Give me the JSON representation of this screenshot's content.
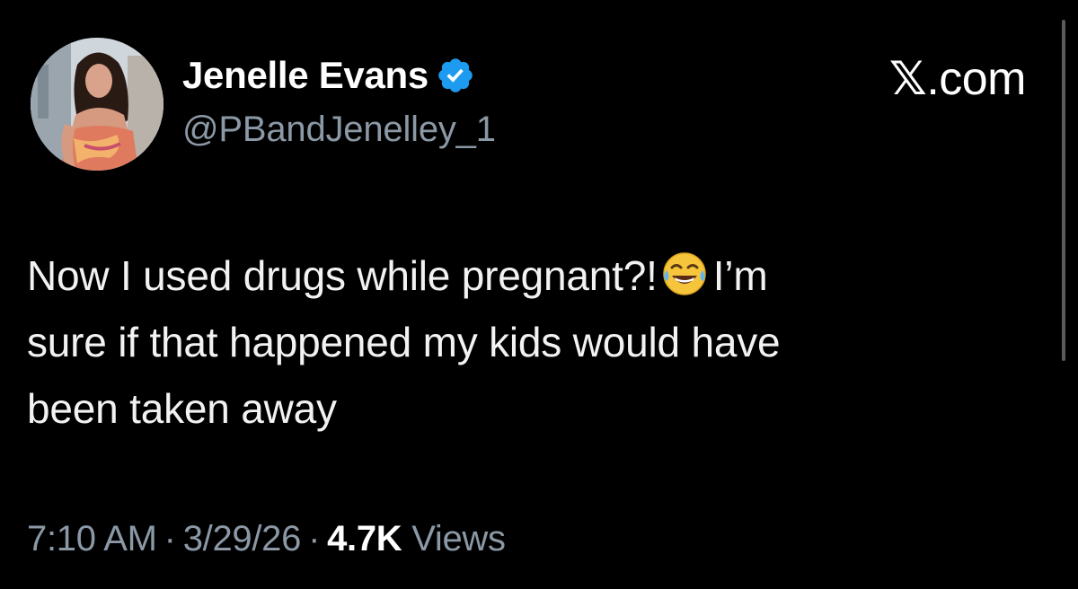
{
  "author": {
    "display_name": "Jenelle Evans",
    "handle": "@PBandJenelley_1",
    "verified": true,
    "verified_color": "#1d9bf0"
  },
  "brand": {
    "x_glyph": "𝕏",
    "suffix": ".com"
  },
  "tweet": {
    "line1_before_emoji": "Now I used drugs while pregnant?!",
    "emoji_icon": "face-with-tears-of-joy",
    "line1_after_emoji": "I’m",
    "line2": "sure if that happened my kids would have",
    "line3": "been taken away"
  },
  "meta": {
    "time": "7:10 AM",
    "separator": "·",
    "date": "3/29/26",
    "views_count": "4.7K",
    "views_label": "Views"
  },
  "colors": {
    "background": "#000000",
    "text": "#f2f2f2",
    "secondary": "#8b98a5"
  }
}
